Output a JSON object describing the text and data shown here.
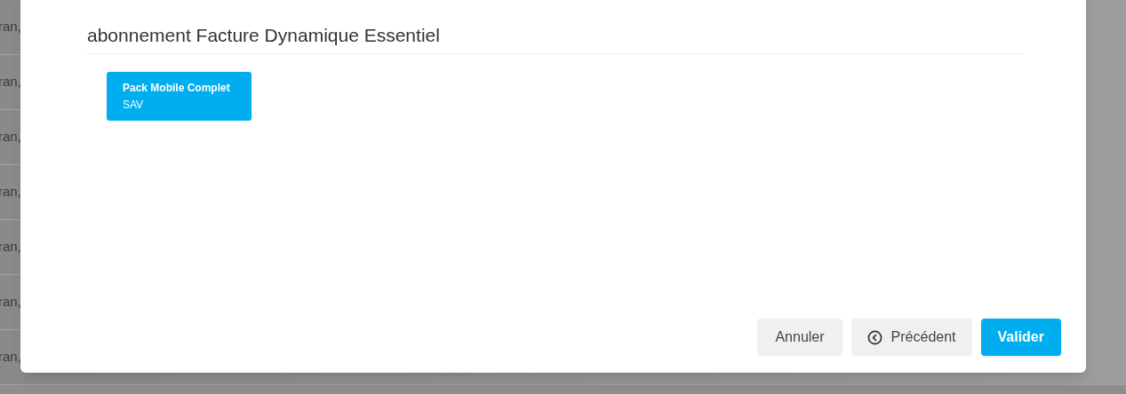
{
  "background_table": {
    "rows": [
      {
        "cell_1": "ran,"
      },
      {
        "cell_1": "ran,"
      },
      {
        "cell_1": "ran,"
      },
      {
        "cell_1": "ran,"
      },
      {
        "cell_1": "ran,"
      },
      {
        "cell_1": "ran,"
      },
      {
        "cell_1": "ran,"
      }
    ]
  },
  "modal": {
    "title": "abonnement Facture Dynamique Essentiel",
    "cards": [
      {
        "title": "Pack Mobile Complet",
        "subtitle": "SAV"
      }
    ],
    "buttons": [
      {
        "kind": "cancel",
        "label": "Annuler"
      },
      {
        "kind": "back",
        "label": "Précédent"
      },
      {
        "kind": "primary",
        "label": "Valider"
      }
    ]
  }
}
